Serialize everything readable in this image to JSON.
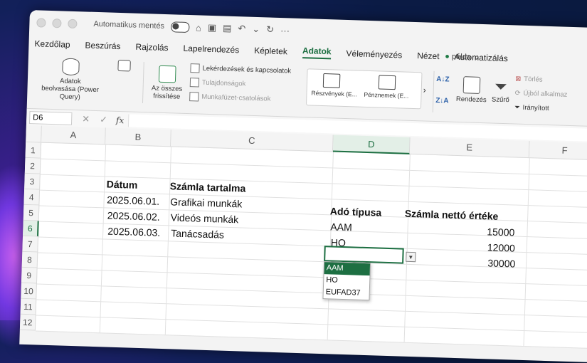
{
  "titlebar": {
    "autosave_label": "Automatikus mentés",
    "more": "···"
  },
  "document": {
    "name": "példa",
    "name_suffix": "⌄"
  },
  "tabs": [
    {
      "label": "Kezdőlap",
      "active": false
    },
    {
      "label": "Beszúrás",
      "active": false
    },
    {
      "label": "Rajzolás",
      "active": false
    },
    {
      "label": "Lapelrendezés",
      "active": false
    },
    {
      "label": "Képletek",
      "active": false
    },
    {
      "label": "Adatok",
      "active": true
    },
    {
      "label": "Véleményezés",
      "active": false
    },
    {
      "label": "Nézet",
      "active": false
    },
    {
      "label": "Automatizálás",
      "active": false
    }
  ],
  "ribbon": {
    "get_data_line1": "Adatok",
    "get_data_line2": "beolvasása (Power Query)",
    "refresh_line1": "Az összes",
    "refresh_line2": "frissítése",
    "queries": "Lekérdezések és kapcsolatok",
    "properties": "Tulajdonságok",
    "workbook_links": "Munkafüzet-csatolások",
    "stocks": "Részvények (E...",
    "currencies": "Pénznemek (E...",
    "sort": "Rendezés",
    "filter": "Szűrő",
    "clear": "Törlés",
    "reapply": "Újból alkalmaz",
    "advanced": "Irányított"
  },
  "formula_bar": {
    "name_box": "D6",
    "cancel": "✕",
    "enter": "✓",
    "fx": "fx",
    "value": ""
  },
  "columns": [
    "A",
    "B",
    "C",
    "D",
    "E",
    "F"
  ],
  "rows": [
    "1",
    "2",
    "3",
    "4",
    "5",
    "6",
    "7",
    "8",
    "9",
    "10",
    "11",
    "12"
  ],
  "selected": {
    "column": "D",
    "row": "6"
  },
  "cells": {
    "B3": "Dátum",
    "C3": "Számla tartalma",
    "D4": "Adó típusa",
    "E4": "Számla nettó értéke",
    "B4": "2025.06.01.",
    "C4": "Grafikai munkák",
    "D5": "AAM",
    "E5": "15000",
    "B5": "2025.06.02.",
    "C5": "Videós munkák",
    "D6": "HO",
    "E6": "12000",
    "B6": "2025.06.03.",
    "C6": "Tanácsadás",
    "E7": "30000"
  },
  "dropdown": {
    "options": [
      "AAM",
      "HO",
      "EUFAD37"
    ],
    "highlighted": "AAM"
  },
  "colors": {
    "accent": "#1d6f42"
  }
}
